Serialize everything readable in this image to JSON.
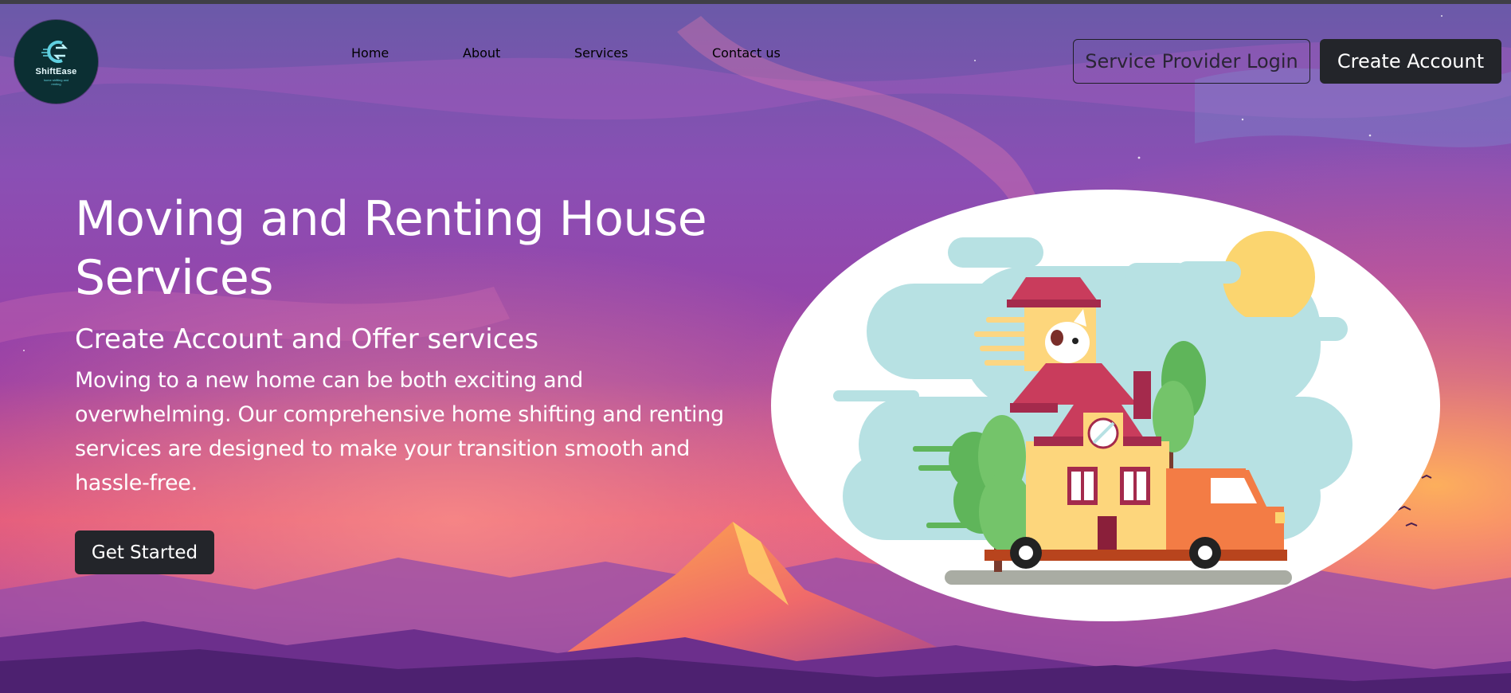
{
  "brand": {
    "logo_name": "ShiftEase",
    "logo_tagline": "home shifting and renting"
  },
  "nav": {
    "items": [
      "Home",
      "About",
      "Services",
      "Contact us"
    ]
  },
  "header_actions": {
    "provider_login": "Service Provider Login",
    "create_account": "Create Account"
  },
  "hero": {
    "title": "Moving and Renting House Services",
    "subtitle": "Create Account and Offer services",
    "description": "Moving to a new home can be both exciting and overwhelming. Our comprehensive home shifting and renting services are designed to make your transition smooth and hassle-free.",
    "cta": "Get Started"
  },
  "illustration": {
    "icon": "house-moving-truck-illustration",
    "colors": {
      "sky": "#b7e1e3",
      "sun": "#fbd56f",
      "roof": "#c93c5c",
      "wall": "#fdd67c",
      "truck": "#f37c45",
      "tree": "#5fb55a"
    }
  },
  "theme": {
    "dark_button": "#23252a",
    "logo_bg": "#0b2f33"
  }
}
